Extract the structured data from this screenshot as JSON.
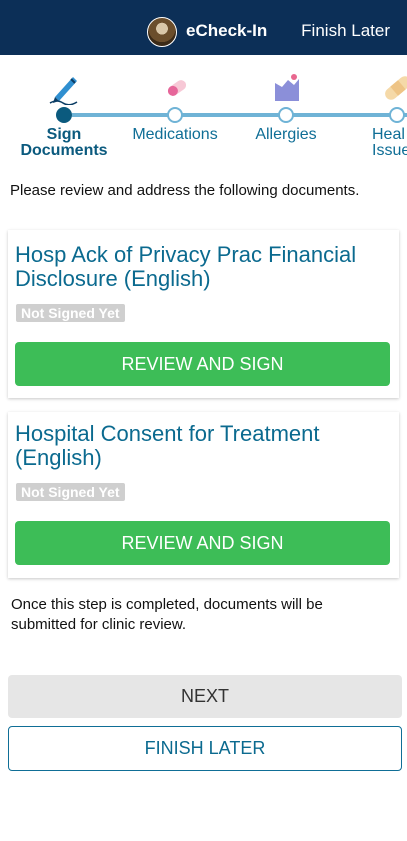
{
  "header": {
    "app_title": "eCheck-In",
    "finish_later": "Finish Later",
    "background": "#0c2f57"
  },
  "steps": [
    {
      "label_line1": "Sign",
      "label_line2": "Documents",
      "icon": "pen-icon",
      "active": true
    },
    {
      "label_line1": "Medications",
      "label_line2": "",
      "icon": "pill-icon",
      "active": false
    },
    {
      "label_line1": "Allergies",
      "label_line2": "",
      "icon": "allergy-icon",
      "active": false
    },
    {
      "label_line1": "Heal",
      "label_line2": "Issue",
      "icon": "bandage-icon",
      "active": false
    }
  ],
  "intro_text": "Please review and address the following documents.",
  "documents": [
    {
      "title_line1": "Hosp Ack of Privacy Prac Financial",
      "title_line2": "Disclosure (English)",
      "status": "Not Signed Yet",
      "action": "REVIEW AND SIGN"
    },
    {
      "title_line1": "Hospital Consent for Treatment",
      "title_line2": "(English)",
      "status": "Not Signed Yet",
      "action": "REVIEW AND SIGN"
    }
  ],
  "note_text": "Once this step is completed, documents will be submitted for clinic review.",
  "buttons": {
    "next": "NEXT",
    "finish_later": "FINISH LATER"
  },
  "colors": {
    "accent": "#0b6a8f",
    "sign_button": "#3dbd57",
    "badge": "#cfcfcf",
    "stepper_line": "#6fb3d6"
  }
}
